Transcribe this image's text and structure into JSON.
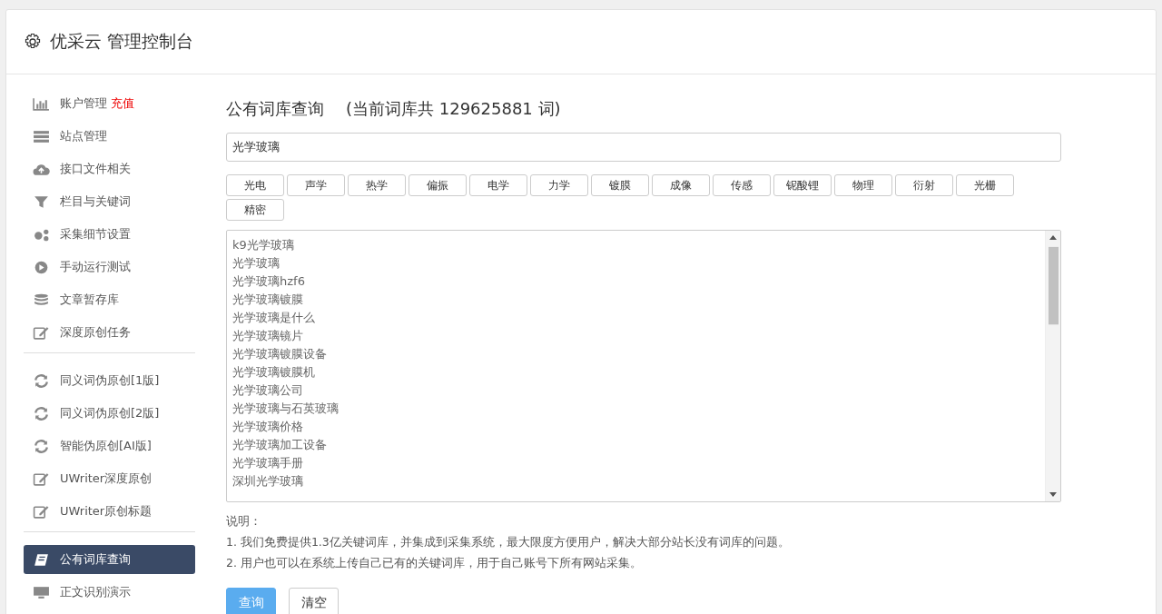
{
  "header": {
    "title": "优采云 管理控制台"
  },
  "sidebar": {
    "groups": [
      [
        {
          "label": "账户管理",
          "badge": "充值",
          "selected": false
        },
        {
          "label": "站点管理",
          "selected": false
        },
        {
          "label": "接口文件相关",
          "selected": false
        },
        {
          "label": "栏目与关键词",
          "selected": false
        },
        {
          "label": "采集细节设置",
          "selected": false
        },
        {
          "label": "手动运行测试",
          "selected": false
        },
        {
          "label": "文章暂存库",
          "selected": false
        },
        {
          "label": "深度原创任务",
          "selected": false
        }
      ],
      [
        {
          "label": "同义词伪原创[1版]",
          "selected": false
        },
        {
          "label": "同义词伪原创[2版]",
          "selected": false
        },
        {
          "label": "智能伪原创[AI版]",
          "selected": false
        },
        {
          "label": "UWriter深度原创",
          "selected": false
        },
        {
          "label": "UWriter原创标题",
          "selected": false
        }
      ],
      [
        {
          "label": "公有词库查询",
          "selected": true
        },
        {
          "label": "正文识别演示",
          "selected": false
        }
      ]
    ]
  },
  "main": {
    "title": "公有词库查询",
    "count_note": "(当前词库共 129625881 词)",
    "search": {
      "value": "光学玻璃"
    },
    "tags": [
      "光电",
      "声学",
      "热学",
      "偏振",
      "电学",
      "力学",
      "镀膜",
      "成像",
      "传感",
      "铌酸锂",
      "物理",
      "衍射",
      "光栅",
      "精密"
    ],
    "results": [
      "k9光学玻璃",
      "光学玻璃",
      "光学玻璃hzf6",
      "光学玻璃镀膜",
      "光学玻璃是什么",
      "光学玻璃镜片",
      "光学玻璃镀膜设备",
      "光学玻璃镀膜机",
      "光学玻璃公司",
      "光学玻璃与石英玻璃",
      "光学玻璃价格",
      "光学玻璃加工设备",
      "光学玻璃手册",
      "深圳光学玻璃"
    ],
    "notes_title": "说明：",
    "notes": [
      "1. 我们免费提供1.3亿关键词库，并集成到采集系统，最大限度方便用户，解决大部分站长没有词库的问题。",
      "2. 用户也可以在系统上传自己已有的关键词库，用于自己账号下所有网站采集。"
    ],
    "buttons": [
      {
        "label": "查询",
        "kind": "primary"
      },
      {
        "label": "清空",
        "kind": "default"
      }
    ]
  }
}
